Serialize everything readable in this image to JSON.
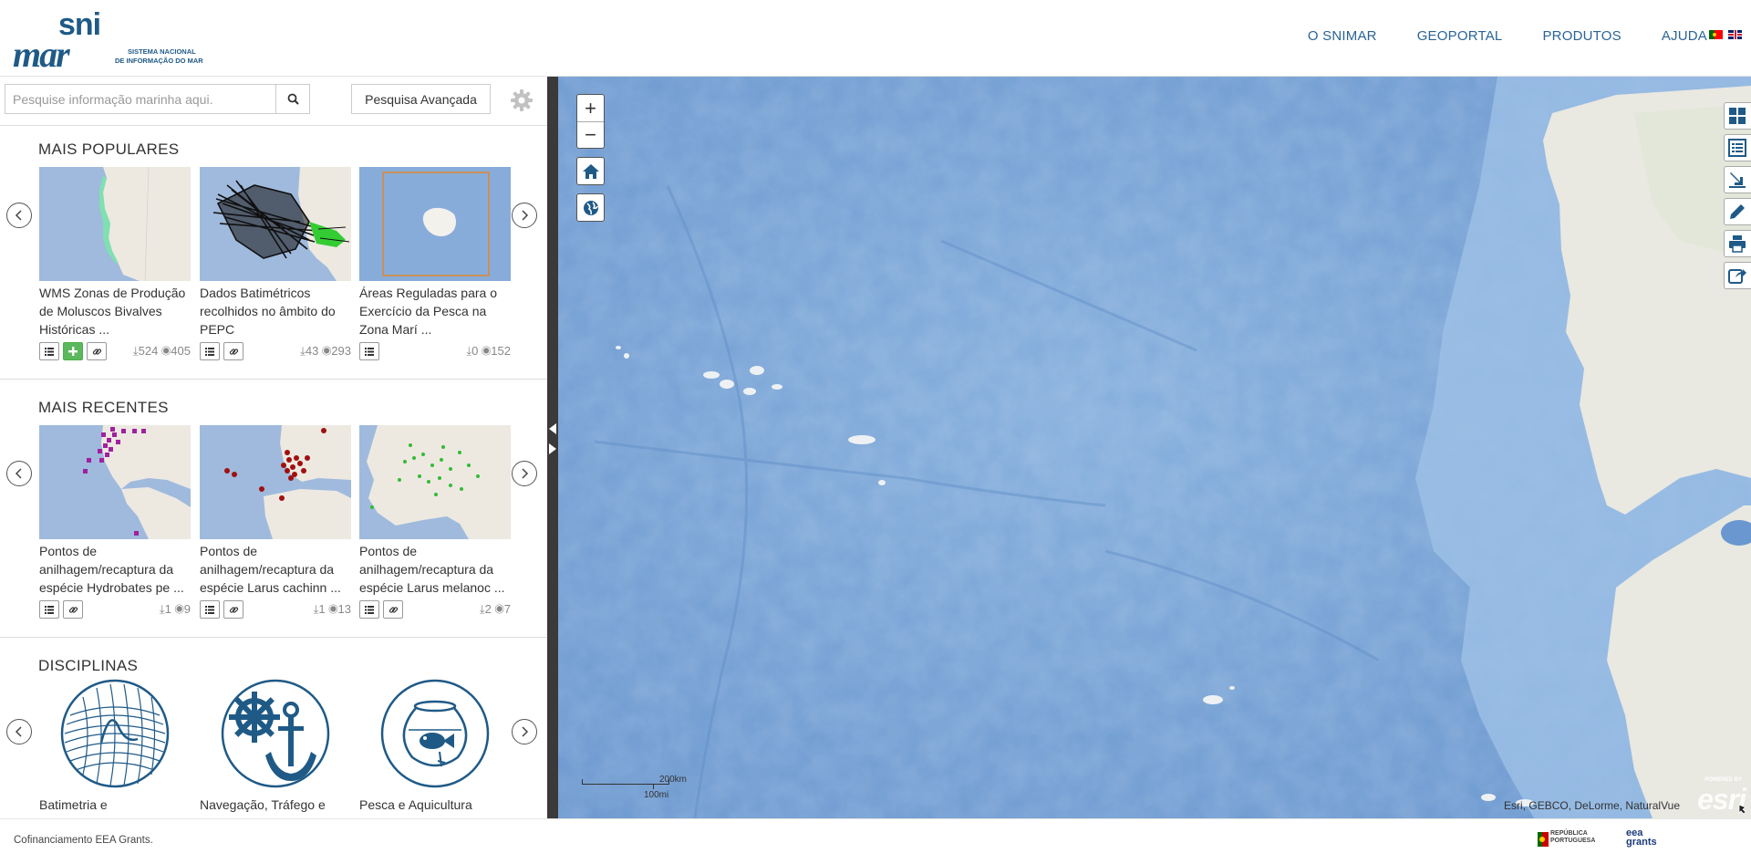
{
  "header": {
    "logo_top": "sni",
    "logo_bottom": "mar",
    "logo_tag1": "SISTEMA NACIONAL",
    "logo_tag2": "DE INFORMAÇÃO DO MAR",
    "nav": [
      "O SNIMAR",
      "GEOPORTAL",
      "PRODUTOS",
      "AJUDA"
    ],
    "flags": [
      "pt-flag",
      "en-flag"
    ]
  },
  "search": {
    "placeholder": "Pesquise informação marinha aqui.",
    "advanced_label": "Pesquisa Avançada"
  },
  "popular": {
    "title": "MAIS POPULARES",
    "cards": [
      {
        "title": "WMS Zonas de Produção de Moluscos Bivalves Históricas ...",
        "downloads": "524",
        "views": "405"
      },
      {
        "title": "Dados Batimétricos recolhidos no âmbito do PEPC",
        "downloads": "43",
        "views": "293"
      },
      {
        "title": "Áreas Reguladas para o Exercício da Pesca na Zona Marí ...",
        "downloads": "0",
        "views": "152"
      }
    ]
  },
  "recent": {
    "title": "MAIS RECENTES",
    "cards": [
      {
        "title": "Pontos de anilhagem/recaptura da espécie Hydrobates pe ...",
        "downloads": "1",
        "views": "9"
      },
      {
        "title": "Pontos de anilhagem/recaptura da espécie Larus cachinn ...",
        "downloads": "1",
        "views": "13"
      },
      {
        "title": "Pontos de anilhagem/recaptura da espécie Larus melanoc ...",
        "downloads": "2",
        "views": "7"
      }
    ]
  },
  "disciplines": {
    "title": "DISCIPLINAS",
    "items": [
      "Batimetria e",
      "Navegação, Tráfego e",
      "Pesca e Aquicultura"
    ]
  },
  "map": {
    "zoom_in": "+",
    "zoom_out": "−",
    "scale_km": "200km",
    "scale_mi": "100mi",
    "attribution": "Esri, GEBCO, DeLorme, NaturalVue",
    "esri_powered": "POWERED BY",
    "esri_logo": "esri",
    "tools": [
      "grid-icon",
      "list-icon",
      "download-icon",
      "pencil-icon",
      "print-icon",
      "share-icon"
    ]
  },
  "footer": {
    "text": "Cofinanciamento EEA Grants.",
    "rp_line1": "REPÚBLICA",
    "rp_line2": "PORTUGUESA",
    "eea_line1": "eea",
    "eea_line2": "grants"
  }
}
